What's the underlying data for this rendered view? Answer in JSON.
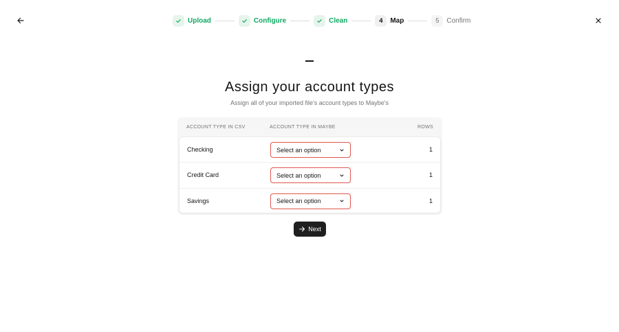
{
  "nav": {
    "back_icon": "arrow-left-icon",
    "close_icon": "close-icon"
  },
  "stepper": {
    "steps": [
      {
        "label": "Upload",
        "status": "complete",
        "badge": "check"
      },
      {
        "label": "Configure",
        "status": "complete",
        "badge": "check"
      },
      {
        "label": "Clean",
        "status": "complete",
        "badge": "check"
      },
      {
        "label": "Map",
        "status": "current",
        "badge": "4"
      },
      {
        "label": "Confirm",
        "status": "upcoming",
        "badge": "5"
      }
    ]
  },
  "header": {
    "title": "Assign your account types",
    "subtitle": "Assign all of your imported file's account types to Maybe's"
  },
  "table": {
    "columns": {
      "csv": "Account type in CSV",
      "maybe": "Account type in Maybe",
      "rows": "Rows"
    },
    "rows": [
      {
        "type": "Checking",
        "select": "Select an option",
        "count": "1"
      },
      {
        "type": "Credit Card",
        "select": "Select an option",
        "count": "1"
      },
      {
        "type": "Savings",
        "select": "Select an option",
        "count": "1"
      }
    ]
  },
  "actions": {
    "next_label": "Next"
  },
  "colors": {
    "success": "#10a861",
    "error_border": "#e0564d",
    "primary_button": "#1f1f1f"
  }
}
